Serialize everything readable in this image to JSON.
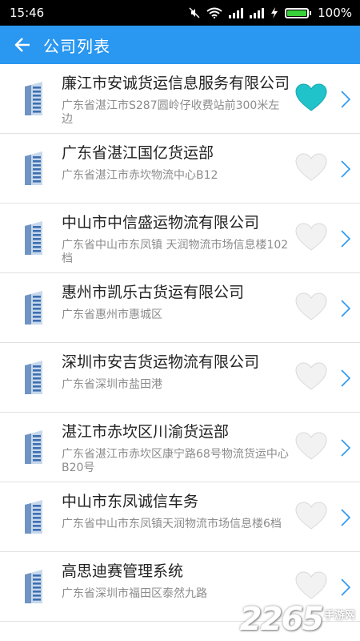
{
  "status_bar": {
    "time": "15:46",
    "battery_text": "100%",
    "battery_level": 1.0,
    "icons": [
      "mute-icon",
      "wifi-icon",
      "signal-icon",
      "signal-icon",
      "charging-icon",
      "battery-icon"
    ]
  },
  "app_bar": {
    "title": "公司列表",
    "back_icon": "arrow-left-icon"
  },
  "colors": {
    "app_bar": "#2a97f0",
    "favorite_active": "#20c3c9",
    "favorite_inactive": "#f2f2f2",
    "chevron": "#2a97f0",
    "divider": "#e2e2e2"
  },
  "companies": [
    {
      "name": "廉江市安诚货运信息服务有限公司",
      "address": "广东省湛江市S287圆岭仔收费站前300米左边",
      "favorite": true
    },
    {
      "name": "广东省湛江国亿货运部",
      "address": "广东省湛江市赤坎物流中心B12",
      "favorite": false
    },
    {
      "name": "中山市中信盛运物流有限公司",
      "address": "广东省中山市东凤镇 天润物流市场信息楼102档",
      "favorite": false
    },
    {
      "name": "惠州市凯乐古货运有限公司",
      "address": "广东省惠州市惠城区",
      "favorite": false
    },
    {
      "name": "深圳市安吉货运物流有限公司",
      "address": "广东省深圳市盐田港",
      "favorite": false
    },
    {
      "name": "湛江市赤坎区川渝货运部",
      "address": "广东省湛江市赤坎区康宁路68号物流货运中心B20号",
      "favorite": false
    },
    {
      "name": "中山市东凤诚信车务",
      "address": "广东省中山市东凤镇天润物流市场信息楼6档",
      "favorite": false
    },
    {
      "name": "高思迪赛管理系统",
      "address": "广东省深圳市福田区泰然九路",
      "favorite": false
    }
  ],
  "watermark": {
    "number": "2265",
    "suffix": "手游网"
  }
}
